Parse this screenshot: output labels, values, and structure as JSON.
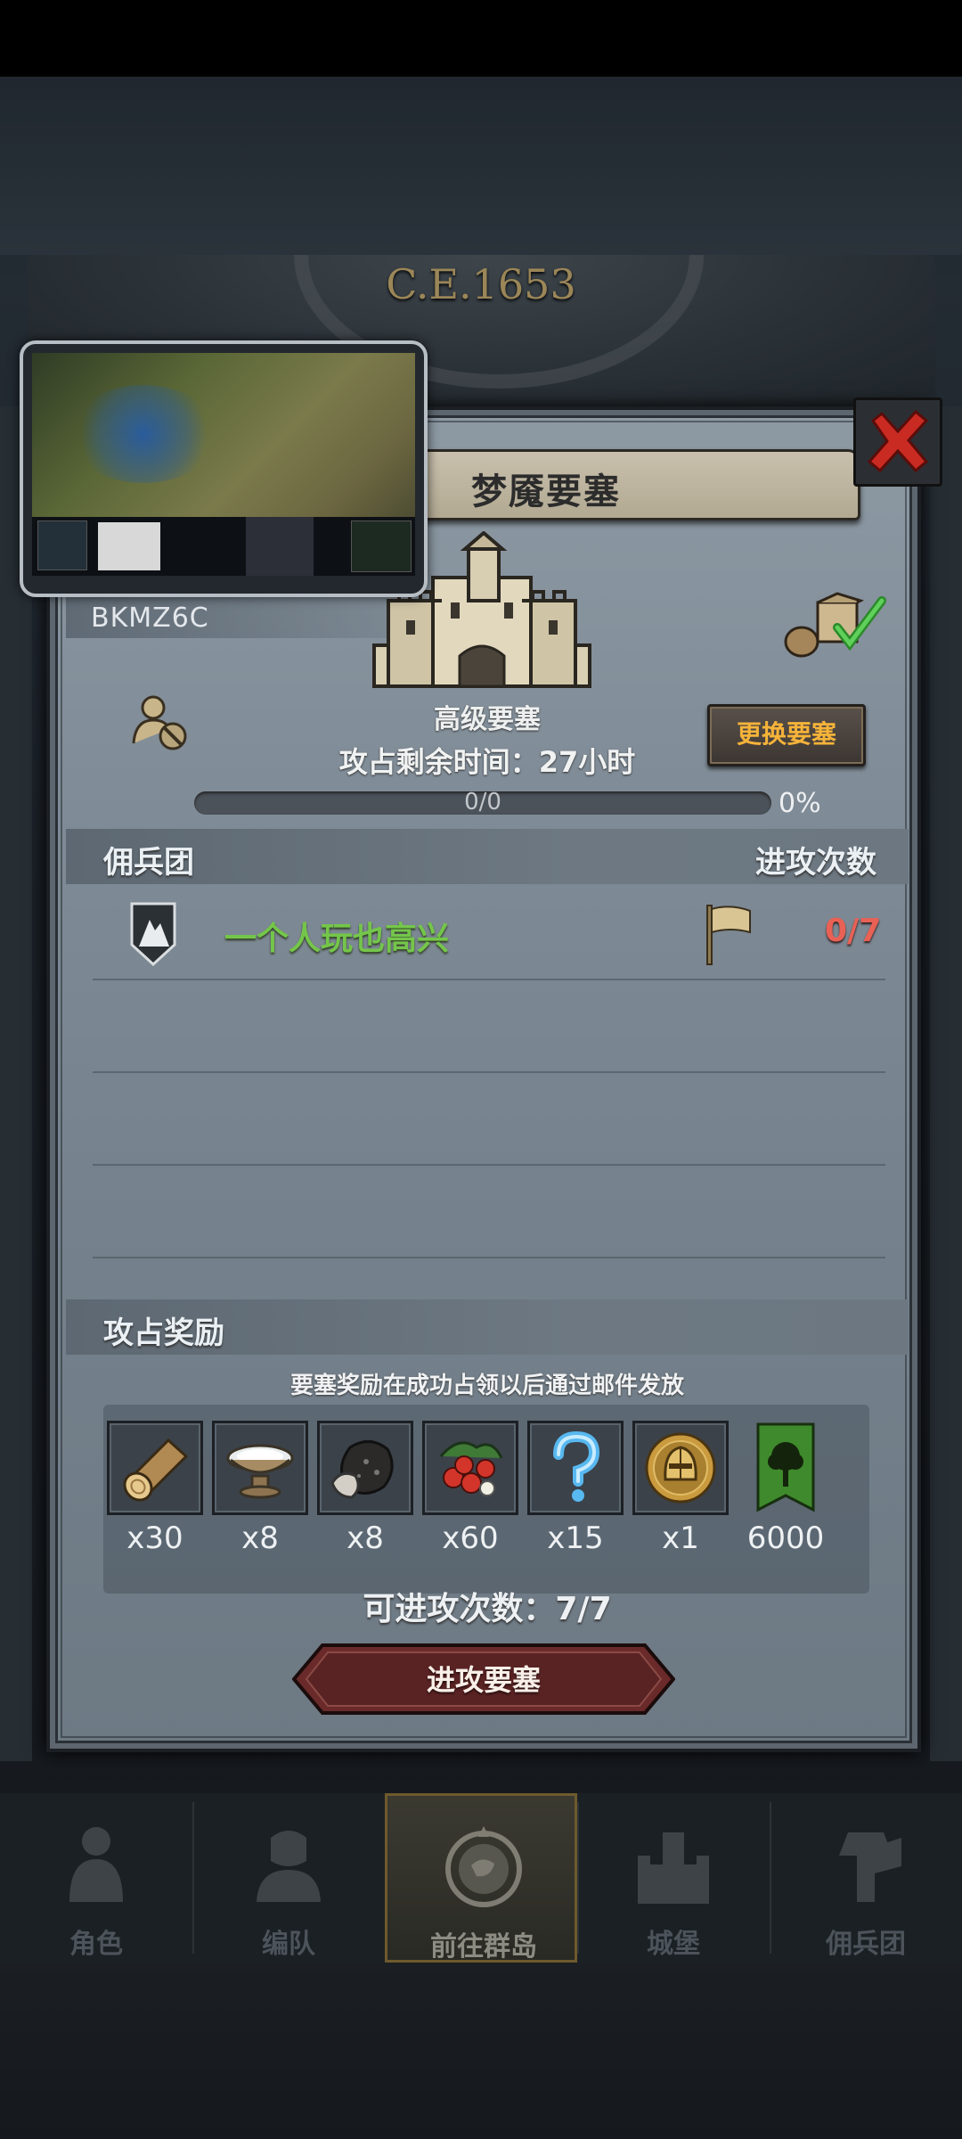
{
  "header": {
    "year": "C.E.1653"
  },
  "fortress": {
    "title": "梦魇要塞",
    "id": "BKMZ6C",
    "level": "高级要塞",
    "time_label": "攻占剩余时间：",
    "time_value": "27小时",
    "progress_text": "0/0",
    "progress_percent": "0%",
    "progress_fraction": 0,
    "swap_button": "更换要塞"
  },
  "mercenary": {
    "header_left": "佣兵团",
    "header_right": "进攻次数",
    "rows": [
      {
        "name": "一个人玩也高兴",
        "attacks": "0/7"
      }
    ]
  },
  "rewards": {
    "header": "攻占奖励",
    "note": "要塞奖励在成功占领以后通过邮件发放",
    "items": [
      {
        "icon": "wood-log-icon",
        "qty": "x30"
      },
      {
        "icon": "milk-bowl-icon",
        "qty": "x8"
      },
      {
        "icon": "stone-ore-icon",
        "qty": "x8"
      },
      {
        "icon": "berries-icon",
        "qty": "x60"
      },
      {
        "icon": "mystery-question-icon",
        "qty": "x15"
      },
      {
        "icon": "knight-helmet-coin-icon",
        "qty": "x1"
      },
      {
        "icon": "tree-banner-icon",
        "qty": "6000"
      }
    ],
    "remaining_label": "可进攻次数：",
    "remaining_value": "7/7",
    "attack_button": "进攻要塞"
  },
  "nav": [
    {
      "label": "角色",
      "icon": "character-icon"
    },
    {
      "label": "编队",
      "icon": "formation-icon"
    },
    {
      "label": "前往群岛",
      "icon": "compass-icon"
    },
    {
      "label": "城堡",
      "icon": "castle-icon"
    },
    {
      "label": "佣兵团",
      "icon": "mercenary-icon"
    }
  ],
  "colors": {
    "guild_name": "#74c64a",
    "attack_count": "#e96155",
    "swap_text": "#f5b33a",
    "attack_button": "#6a2a2a"
  }
}
